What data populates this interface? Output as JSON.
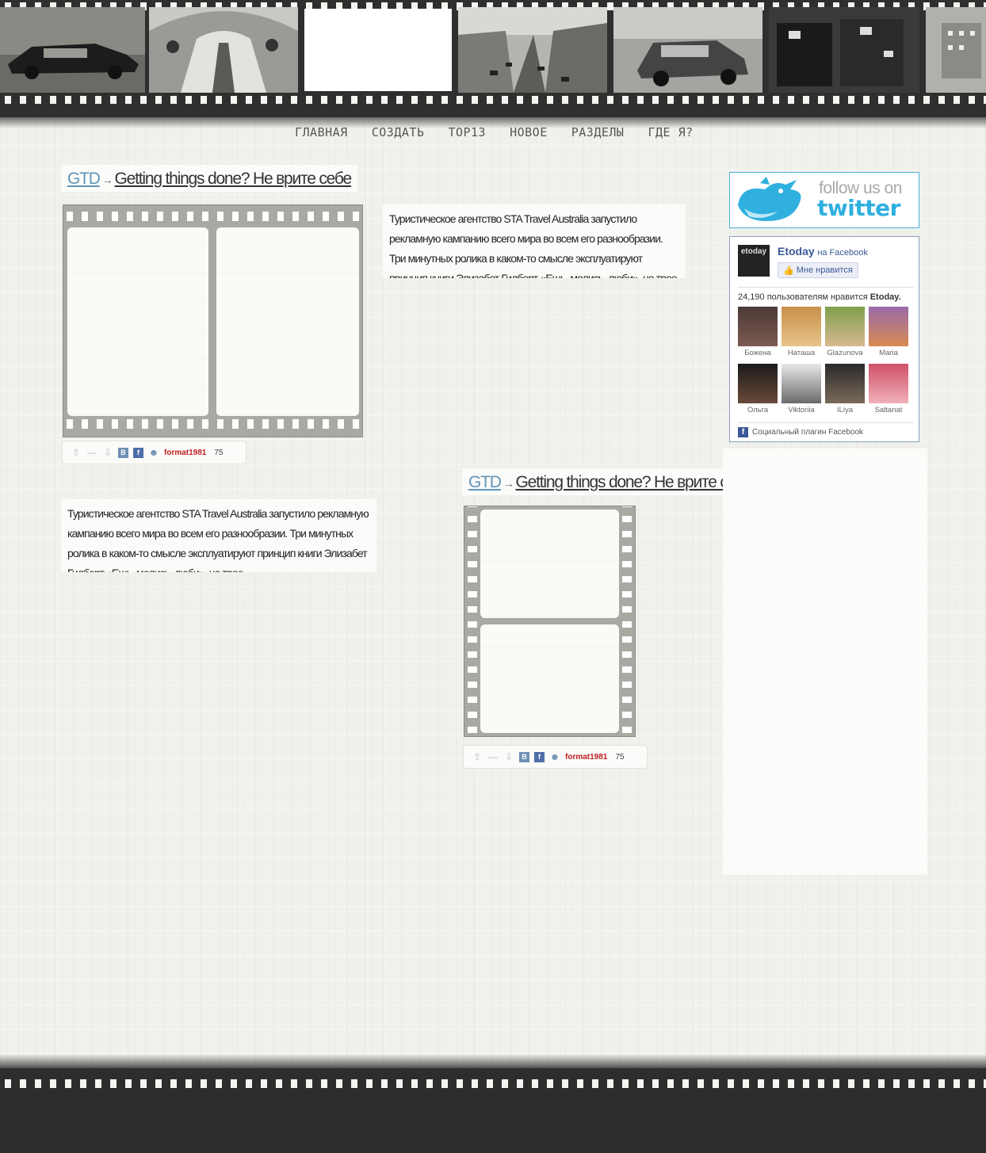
{
  "nav": {
    "items": [
      "ГЛАВНАЯ",
      "СОЗДАТЬ",
      "TOP13",
      "НОВОЕ",
      "РАЗДЕЛЫ",
      "ГДЕ Я?"
    ]
  },
  "posts": [
    {
      "category": "GTD",
      "arrow": "→",
      "title": "Getting things done? Не врите себе",
      "stats": {
        "user": "format1981",
        "score": "75",
        "vk": "В",
        "fb": "f"
      }
    },
    {
      "category": "GTD",
      "arrow": "→",
      "title": "Getting things done? Не врите себе",
      "stats": {
        "user": "format1981",
        "score": "75",
        "vk": "В",
        "fb": "f"
      }
    }
  ],
  "excerpts": [
    "Туристическое агентство STA Travel Australia запустило рекламную кампанию всего мира во всем его разнообразии. Три минутных ролика в каком-то смысле эксплуатируют принцип книги Элизабет Гилберт «Ешь, молись, люби», но трое",
    "Туристическое агентство STA Travel Australia запустило рекламную кампанию всего мира во всем его разнообразии. Три минутных ролика в каком-то смысле эксплуатируют принцип книги Элизабет Гилберт «Ешь, молись, люби», но трое"
  ],
  "twitter": {
    "follow": "follow us on",
    "brand": "twitter"
  },
  "facebook": {
    "logo": "etoday",
    "page_name": "Etoday",
    "on_facebook": "на Facebook",
    "like_label": "Мне нравится",
    "count_prefix": "24,190 пользователям нравится",
    "count_page": "Etoday.",
    "faces": [
      "Божена",
      "Наташа",
      "Glazunova",
      "Maria",
      "Ольга",
      "Viktoriia",
      "ILiya",
      "Saltanat"
    ],
    "plugin_label": "Социальный плагин Facebook"
  }
}
